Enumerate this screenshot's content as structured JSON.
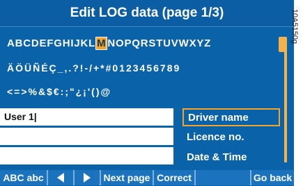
{
  "title": "Edit LOG data (page 1/3)",
  "charset": {
    "row1_before": "ABCDEFGHIJKL",
    "row1_selected": "M",
    "row1_after": "NOPQRSTUVWXYZ",
    "row2": "ÄÖÜÑÉÇ_,.?!-/+*#0123456789",
    "row3": "<=>%&$€:;\"¿¡'()@"
  },
  "fields": [
    {
      "value": "User 1|"
    },
    {
      "value": ""
    },
    {
      "value": ""
    }
  ],
  "menu": [
    {
      "label": "Driver name"
    },
    {
      "label": "Licence no."
    },
    {
      "label": "Date & Time"
    }
  ],
  "buttons": {
    "abc": "ABC abc",
    "next_page": "Next page",
    "correct": "Correct",
    "go_back": "Go back"
  },
  "side_code": "10A5150g",
  "colors": {
    "background": "#0a62a8",
    "accent": "#f4a42a",
    "button": "#1a73bc"
  }
}
